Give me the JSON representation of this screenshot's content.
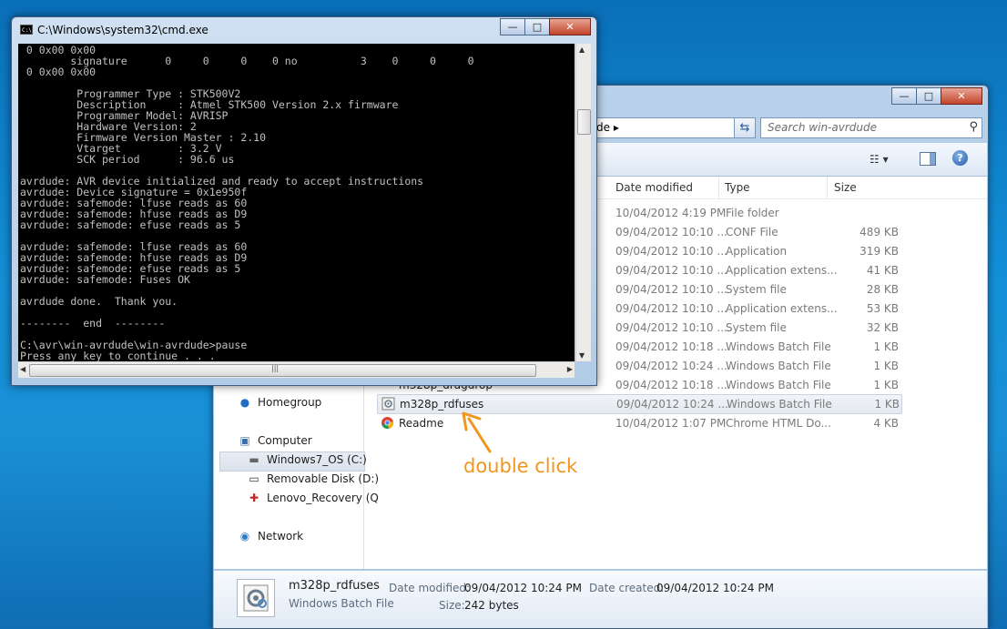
{
  "cmd": {
    "title": "C:\\Windows\\system32\\cmd.exe",
    "icon_label": "C:\\",
    "output": " 0 0x00 0x00\n        signature      0     0     0    0 no          3    0     0     0\n 0 0x00 0x00\n\n         Programmer Type : STK500V2\n         Description     : Atmel STK500 Version 2.x firmware\n         Programmer Model: AVRISP\n         Hardware Version: 2\n         Firmware Version Master : 2.10\n         Vtarget         : 3.2 V\n         SCK period      : 96.6 us\n\navrdude: AVR device initialized and ready to accept instructions\navrdude: Device signature = 0x1e950f\navrdude: safemode: lfuse reads as 60\navrdude: safemode: hfuse reads as D9\navrdude: safemode: efuse reads as 5\n\navrdude: safemode: lfuse reads as 60\navrdude: safemode: hfuse reads as D9\navrdude: safemode: efuse reads as 5\navrdude: safemode: Fuses OK\n\navrdude done.  Thank you.\n\n--------  end  --------\n\nC:\\avr\\win-avrdude\\win-avrdude>pause\nPress any key to continue . . .",
    "controls": {
      "minimize": "—",
      "maximize": "□",
      "close": "✕"
    }
  },
  "explorer": {
    "address_tail": "de",
    "address_sep": "▸",
    "search_placeholder": "Search win-avrdude",
    "controls": {
      "minimize": "—",
      "maximize": "□",
      "close": "✕"
    },
    "columns": {
      "date": "Date modified",
      "type": "Type",
      "size": "Size"
    },
    "nav": {
      "homegroup": "Homegroup",
      "computer": "Computer",
      "windows_os": "Windows7_OS (C:)",
      "removable": "Removable Disk (D:)",
      "recovery": "Lenovo_Recovery (Q",
      "network": "Network"
    },
    "rows": [
      {
        "name": "",
        "date": "10/04/2012 4:19 PM",
        "type": "File folder",
        "size": ""
      },
      {
        "name": "",
        "date": "09/04/2012 10:10 ...",
        "type": "CONF File",
        "size": "489 KB"
      },
      {
        "name": "",
        "date": "09/04/2012 10:10 ...",
        "type": "Application",
        "size": "319 KB"
      },
      {
        "name": "",
        "date": "09/04/2012 10:10 ...",
        "type": "Application extens...",
        "size": "41 KB"
      },
      {
        "name": "",
        "date": "09/04/2012 10:10 ...",
        "type": "System file",
        "size": "28 KB"
      },
      {
        "name": "",
        "date": "09/04/2012 10:10 ...",
        "type": "Application extens...",
        "size": "53 KB"
      },
      {
        "name": "",
        "date": "09/04/2012 10:10 ...",
        "type": "System file",
        "size": "32 KB"
      },
      {
        "name": "",
        "date": "09/04/2012 10:18 ...",
        "type": "Windows Batch File",
        "size": "1 KB"
      },
      {
        "name": "",
        "date": "09/04/2012 10:24 ...",
        "type": "Windows Batch File",
        "size": "1 KB"
      },
      {
        "name": "m328p_dragdrop",
        "date": "09/04/2012 10:18 ...",
        "type": "Windows Batch File",
        "size": "1 KB"
      },
      {
        "name": "m328p_rdfuses",
        "date": "09/04/2012 10:24 ...",
        "type": "Windows Batch File",
        "size": "1 KB"
      },
      {
        "name": "Readme",
        "date": "10/04/2012 1:07 PM",
        "type": "Chrome HTML Do...",
        "size": "4 KB"
      }
    ],
    "details": {
      "name": "m328p_rdfuses",
      "type": "Windows Batch File",
      "date_modified_label": "Date modified:",
      "date_modified": "09/04/2012 10:24 PM",
      "date_created_label": "Date created:",
      "date_created": "09/04/2012 10:24 PM",
      "size_label": "Size:",
      "size": "242 bytes"
    }
  },
  "annotation": {
    "text": "double click",
    "color": "#f0961e"
  },
  "colors": {
    "desktop": "#1390d8",
    "console_bg": "#000000",
    "console_fg": "#c0c0c0",
    "selection": "#e3e9f0"
  }
}
